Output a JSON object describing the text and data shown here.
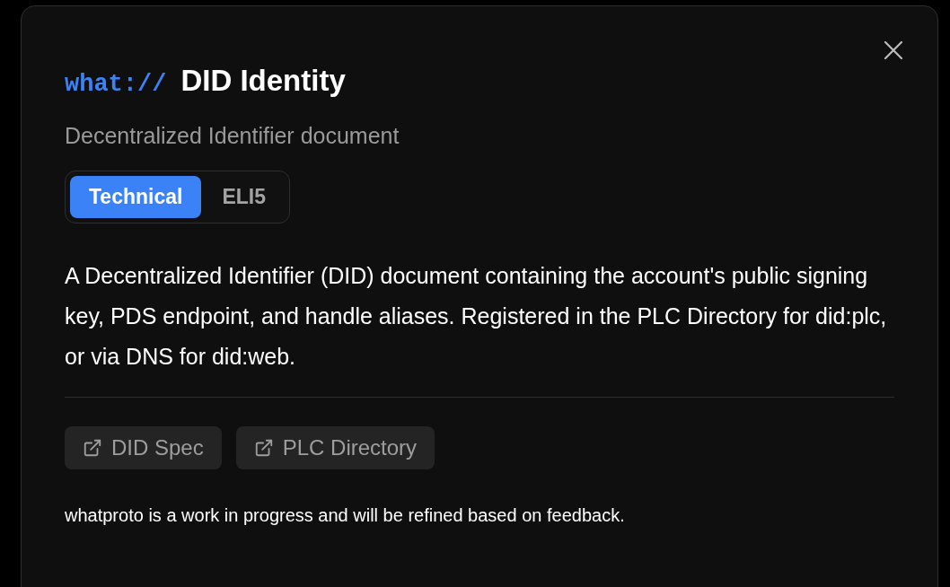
{
  "dialog": {
    "scheme": "what://",
    "title": "DID Identity",
    "subtitle": "Decentralized Identifier document",
    "tabs": [
      {
        "label": "Technical",
        "selected": true
      },
      {
        "label": "ELI5",
        "selected": false
      }
    ],
    "description": "A Decentralized Identifier (DID) document containing the account's public signing key, PDS endpoint, and handle aliases. Registered in the PLC Directory for did:plc, or via DNS for did:web.",
    "links": [
      {
        "label": "DID Spec"
      },
      {
        "label": "PLC Directory"
      }
    ],
    "footer": "whatproto is a work in progress and will be refined based on feedback."
  }
}
